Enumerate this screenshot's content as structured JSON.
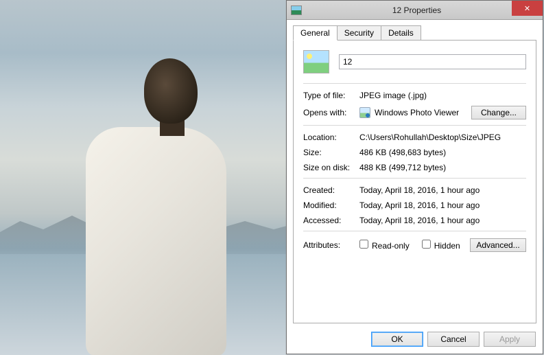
{
  "window": {
    "title": "12 Properties",
    "close_glyph": "✕"
  },
  "tabs": {
    "general": "General",
    "security": "Security",
    "details": "Details"
  },
  "file": {
    "name": "12"
  },
  "labels": {
    "type_of_file": "Type of file:",
    "opens_with": "Opens with:",
    "location": "Location:",
    "size": "Size:",
    "size_on_disk": "Size on disk:",
    "created": "Created:",
    "modified": "Modified:",
    "accessed": "Accessed:",
    "attributes": "Attributes:"
  },
  "values": {
    "type_of_file": "JPEG image (.jpg)",
    "opens_with": "Windows Photo Viewer",
    "location": "C:\\Users\\Rohullah\\Desktop\\Size\\JPEG",
    "size": "486 KB (498,683 bytes)",
    "size_on_disk": "488 KB (499,712 bytes)",
    "created": "Today, April 18, 2016, 1 hour ago",
    "modified": "Today, April 18, 2016, 1 hour ago",
    "accessed": "Today, April 18, 2016, 1 hour ago"
  },
  "attributes": {
    "read_only": "Read-only",
    "hidden": "Hidden"
  },
  "buttons": {
    "change": "Change...",
    "advanced": "Advanced...",
    "ok": "OK",
    "cancel": "Cancel",
    "apply": "Apply"
  }
}
